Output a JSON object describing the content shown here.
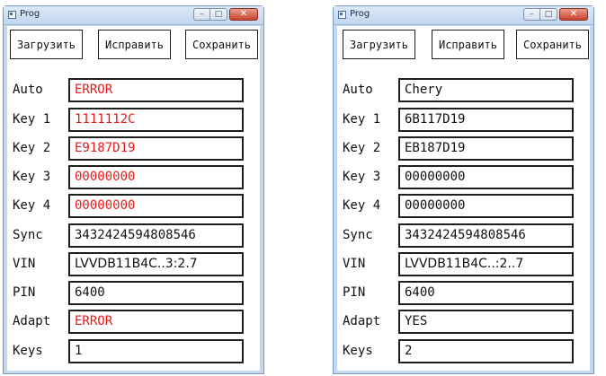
{
  "windows": [
    {
      "title": "Prog",
      "buttons": {
        "load": "Загрузить",
        "fix": "Исправить",
        "save": "Сохранить"
      },
      "fields": {
        "auto": {
          "label": "Auto",
          "value": "ERROR"
        },
        "key1": {
          "label": "Key 1",
          "value": "1111112C"
        },
        "key2": {
          "label": "Key 2",
          "value": "E9187D19"
        },
        "key3": {
          "label": "Key 3",
          "value": "00000000"
        },
        "key4": {
          "label": "Key 4",
          "value": "00000000"
        },
        "sync": {
          "label": "Sync",
          "value": "3432424594808546"
        },
        "vin": {
          "label": "VIN",
          "value": "LVVDB11B4C..3:2.7"
        },
        "pin": {
          "label": "PIN",
          "value": "6400"
        },
        "adapt": {
          "label": "Adapt",
          "value": "ERROR"
        },
        "keys": {
          "label": "Keys",
          "value": "1"
        }
      }
    },
    {
      "title": "Prog",
      "buttons": {
        "load": "Загрузить",
        "fix": "Исправить",
        "save": "Сохранить"
      },
      "fields": {
        "auto": {
          "label": "Auto",
          "value": "Chery"
        },
        "key1": {
          "label": "Key 1",
          "value": "6B117D19"
        },
        "key2": {
          "label": "Key 2",
          "value": "EB187D19"
        },
        "key3": {
          "label": "Key 3",
          "value": "00000000"
        },
        "key4": {
          "label": "Key 4",
          "value": "00000000"
        },
        "sync": {
          "label": "Sync",
          "value": "3432424594808546"
        },
        "vin": {
          "label": "VIN",
          "value": "LVVDB11B4C..:2..7"
        },
        "pin": {
          "label": "PIN",
          "value": "6400"
        },
        "adapt": {
          "label": "Adapt",
          "value": "YES"
        },
        "keys": {
          "label": "Keys",
          "value": "2"
        }
      }
    }
  ],
  "colors": {
    "error_text": "#e81919",
    "normal_text": "#111111"
  }
}
